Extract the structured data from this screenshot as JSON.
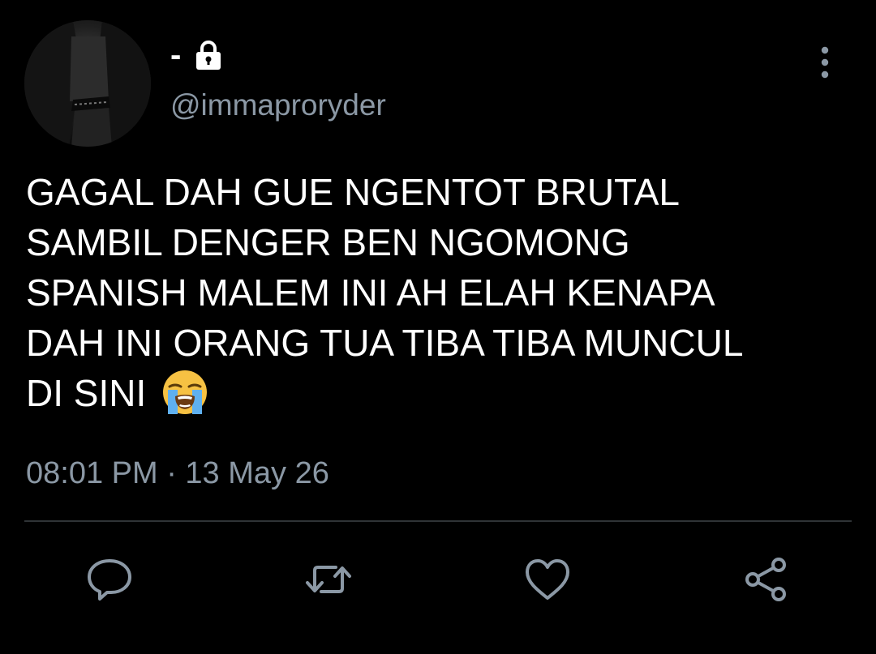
{
  "tweet": {
    "display_name": "-",
    "handle": "@immaproryder",
    "text": "GAGAL DAH GUE NGENTOT BRUTAL\nSAMBIL DENGER BEN NGOMONG\nSPANISH MALEM INI AH ELAH KENAPA\nDAH INI ORANG TUA TIBA TIBA MUNCUL\nDI SINI ",
    "emoji": "loudly-crying-face",
    "timestamp": "08:01 PM · 13 May 26"
  },
  "icons": {
    "lock": "lock-icon",
    "more": "more-vertical-icon",
    "reply": "reply-icon",
    "retweet": "retweet-icon",
    "like": "heart-icon",
    "share": "share-icon"
  },
  "colors": {
    "background": "#000000",
    "text": "#ffffff",
    "secondary": "#8b98a5",
    "divider": "#2f3336"
  }
}
